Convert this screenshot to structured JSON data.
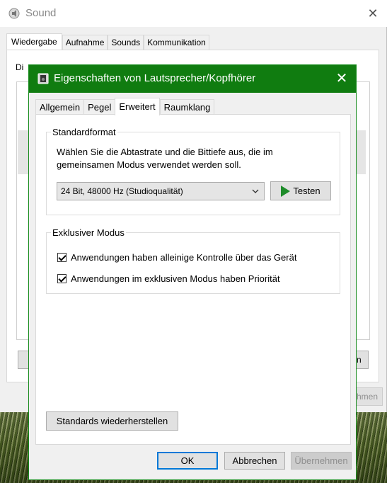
{
  "background_window": {
    "title": "Sound",
    "tabs": [
      "Wiedergabe",
      "Aufnahme",
      "Sounds",
      "Kommunikation"
    ],
    "description_partial": "Di",
    "button_left_partial": "K",
    "button_right_partial": "n",
    "apply_partial": "hmen"
  },
  "dialog": {
    "title": "Eigenschaften von Lautsprecher/Kopfhörer",
    "tabs": [
      "Allgemein",
      "Pegel",
      "Erweitert",
      "Raumklang"
    ],
    "active_tab": "Erweitert",
    "standard_format": {
      "legend": "Standardformat",
      "description": "Wählen Sie die Abtastrate und die Bittiefe aus, die im gemeinsamen Modus verwendet werden soll.",
      "selected_format": "24 Bit, 48000 Hz (Studioqualität)",
      "test_button": "Testen"
    },
    "exclusive_mode": {
      "legend": "Exklusiver Modus",
      "option1": "Anwendungen haben alleinige Kontrolle über das Gerät",
      "option1_checked": true,
      "option2": "Anwendungen im exklusiven Modus haben Priorität",
      "option2_checked": true
    },
    "restore_defaults_button": "Standards wiederherstellen",
    "ok_button": "OK",
    "cancel_button": "Abbrechen",
    "apply_button": "Übernehmen"
  },
  "colors": {
    "titlebar_accent": "#107c10",
    "play_icon": "#1e8c2a",
    "focus_border": "#0078d7"
  }
}
